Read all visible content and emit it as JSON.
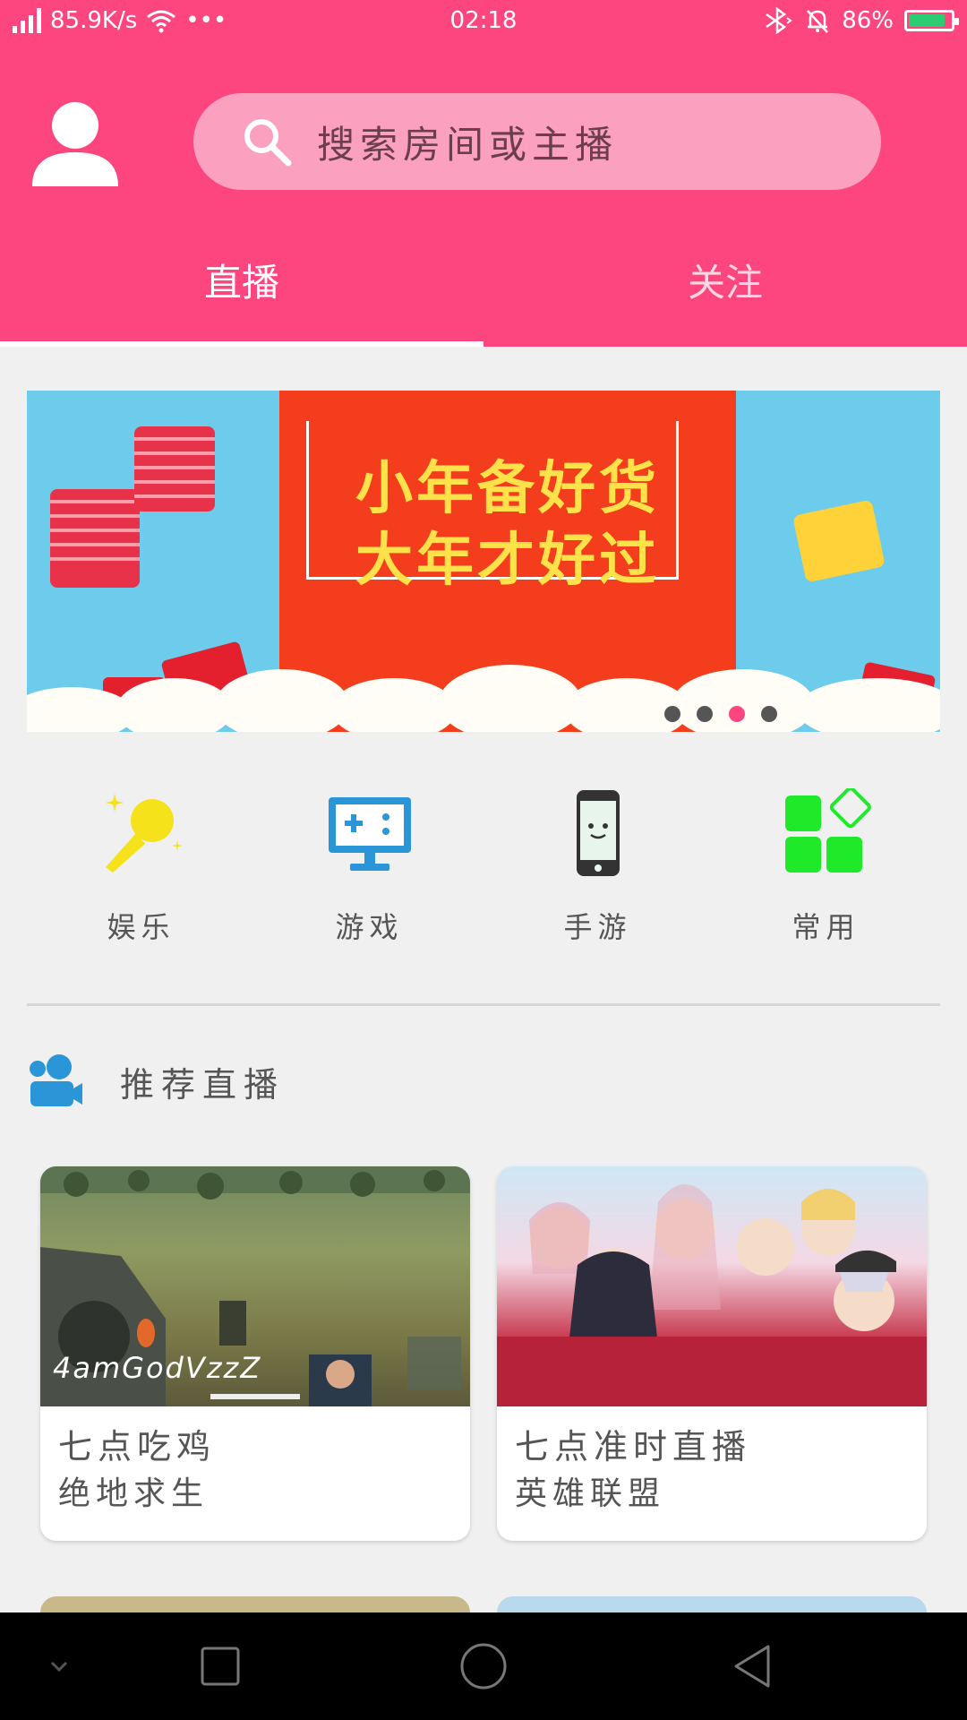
{
  "status_bar": {
    "speed": "85.9K/s",
    "more": "•••",
    "time": "02:18",
    "battery": "86%"
  },
  "search": {
    "placeholder": "搜索房间或主播"
  },
  "tabs": [
    {
      "label": "直播",
      "active": true
    },
    {
      "label": "关注",
      "active": false
    }
  ],
  "banner": {
    "line1": "小年备好货",
    "line2": "大年才好过",
    "page_count": 4,
    "active_page": 3
  },
  "categories": [
    {
      "label": "娱乐",
      "icon": "microphone-icon"
    },
    {
      "label": "游戏",
      "icon": "game-monitor-icon"
    },
    {
      "label": "手游",
      "icon": "phone-icon"
    },
    {
      "label": "常用",
      "icon": "grid-icon"
    }
  ],
  "recommend": {
    "title": "推荐直播"
  },
  "cards": [
    {
      "title": "七点吃鸡",
      "subtitle": "绝地求生",
      "overlay": "4amGodVzzZ"
    },
    {
      "title": "七点准时直播",
      "subtitle": "英雄联盟"
    }
  ],
  "colors": {
    "accent": "#fd4680",
    "search_bg": "#fba0be",
    "tab_inactive": "#ffd6e4"
  }
}
